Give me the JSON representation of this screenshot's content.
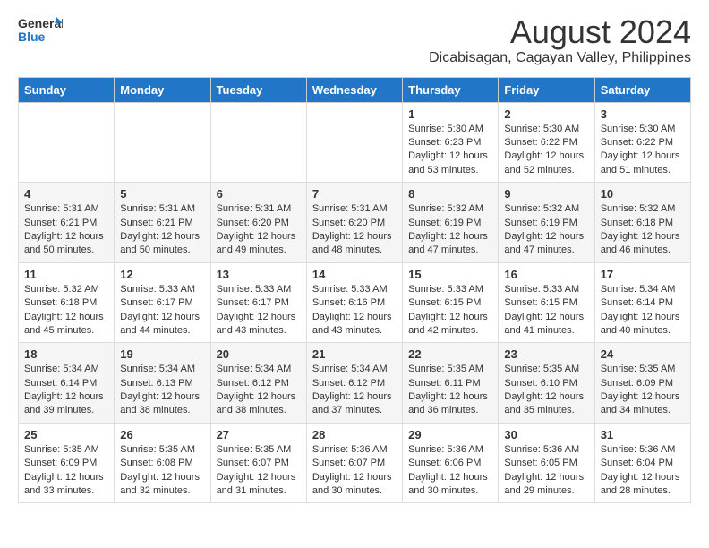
{
  "logo": {
    "line1": "General",
    "line2": "Blue"
  },
  "title": "August 2024",
  "subtitle": "Dicabisagan, Cagayan Valley, Philippines",
  "days_header": [
    "Sunday",
    "Monday",
    "Tuesday",
    "Wednesday",
    "Thursday",
    "Friday",
    "Saturday"
  ],
  "weeks": [
    [
      {
        "day": "",
        "info": ""
      },
      {
        "day": "",
        "info": ""
      },
      {
        "day": "",
        "info": ""
      },
      {
        "day": "",
        "info": ""
      },
      {
        "day": "1",
        "info": "Sunrise: 5:30 AM\nSunset: 6:23 PM\nDaylight: 12 hours\nand 53 minutes."
      },
      {
        "day": "2",
        "info": "Sunrise: 5:30 AM\nSunset: 6:22 PM\nDaylight: 12 hours\nand 52 minutes."
      },
      {
        "day": "3",
        "info": "Sunrise: 5:30 AM\nSunset: 6:22 PM\nDaylight: 12 hours\nand 51 minutes."
      }
    ],
    [
      {
        "day": "4",
        "info": "Sunrise: 5:31 AM\nSunset: 6:21 PM\nDaylight: 12 hours\nand 50 minutes."
      },
      {
        "day": "5",
        "info": "Sunrise: 5:31 AM\nSunset: 6:21 PM\nDaylight: 12 hours\nand 50 minutes."
      },
      {
        "day": "6",
        "info": "Sunrise: 5:31 AM\nSunset: 6:20 PM\nDaylight: 12 hours\nand 49 minutes."
      },
      {
        "day": "7",
        "info": "Sunrise: 5:31 AM\nSunset: 6:20 PM\nDaylight: 12 hours\nand 48 minutes."
      },
      {
        "day": "8",
        "info": "Sunrise: 5:32 AM\nSunset: 6:19 PM\nDaylight: 12 hours\nand 47 minutes."
      },
      {
        "day": "9",
        "info": "Sunrise: 5:32 AM\nSunset: 6:19 PM\nDaylight: 12 hours\nand 47 minutes."
      },
      {
        "day": "10",
        "info": "Sunrise: 5:32 AM\nSunset: 6:18 PM\nDaylight: 12 hours\nand 46 minutes."
      }
    ],
    [
      {
        "day": "11",
        "info": "Sunrise: 5:32 AM\nSunset: 6:18 PM\nDaylight: 12 hours\nand 45 minutes."
      },
      {
        "day": "12",
        "info": "Sunrise: 5:33 AM\nSunset: 6:17 PM\nDaylight: 12 hours\nand 44 minutes."
      },
      {
        "day": "13",
        "info": "Sunrise: 5:33 AM\nSunset: 6:17 PM\nDaylight: 12 hours\nand 43 minutes."
      },
      {
        "day": "14",
        "info": "Sunrise: 5:33 AM\nSunset: 6:16 PM\nDaylight: 12 hours\nand 43 minutes."
      },
      {
        "day": "15",
        "info": "Sunrise: 5:33 AM\nSunset: 6:15 PM\nDaylight: 12 hours\nand 42 minutes."
      },
      {
        "day": "16",
        "info": "Sunrise: 5:33 AM\nSunset: 6:15 PM\nDaylight: 12 hours\nand 41 minutes."
      },
      {
        "day": "17",
        "info": "Sunrise: 5:34 AM\nSunset: 6:14 PM\nDaylight: 12 hours\nand 40 minutes."
      }
    ],
    [
      {
        "day": "18",
        "info": "Sunrise: 5:34 AM\nSunset: 6:14 PM\nDaylight: 12 hours\nand 39 minutes."
      },
      {
        "day": "19",
        "info": "Sunrise: 5:34 AM\nSunset: 6:13 PM\nDaylight: 12 hours\nand 38 minutes."
      },
      {
        "day": "20",
        "info": "Sunrise: 5:34 AM\nSunset: 6:12 PM\nDaylight: 12 hours\nand 38 minutes."
      },
      {
        "day": "21",
        "info": "Sunrise: 5:34 AM\nSunset: 6:12 PM\nDaylight: 12 hours\nand 37 minutes."
      },
      {
        "day": "22",
        "info": "Sunrise: 5:35 AM\nSunset: 6:11 PM\nDaylight: 12 hours\nand 36 minutes."
      },
      {
        "day": "23",
        "info": "Sunrise: 5:35 AM\nSunset: 6:10 PM\nDaylight: 12 hours\nand 35 minutes."
      },
      {
        "day": "24",
        "info": "Sunrise: 5:35 AM\nSunset: 6:09 PM\nDaylight: 12 hours\nand 34 minutes."
      }
    ],
    [
      {
        "day": "25",
        "info": "Sunrise: 5:35 AM\nSunset: 6:09 PM\nDaylight: 12 hours\nand 33 minutes."
      },
      {
        "day": "26",
        "info": "Sunrise: 5:35 AM\nSunset: 6:08 PM\nDaylight: 12 hours\nand 32 minutes."
      },
      {
        "day": "27",
        "info": "Sunrise: 5:35 AM\nSunset: 6:07 PM\nDaylight: 12 hours\nand 31 minutes."
      },
      {
        "day": "28",
        "info": "Sunrise: 5:36 AM\nSunset: 6:07 PM\nDaylight: 12 hours\nand 30 minutes."
      },
      {
        "day": "29",
        "info": "Sunrise: 5:36 AM\nSunset: 6:06 PM\nDaylight: 12 hours\nand 30 minutes."
      },
      {
        "day": "30",
        "info": "Sunrise: 5:36 AM\nSunset: 6:05 PM\nDaylight: 12 hours\nand 29 minutes."
      },
      {
        "day": "31",
        "info": "Sunrise: 5:36 AM\nSunset: 6:04 PM\nDaylight: 12 hours\nand 28 minutes."
      }
    ]
  ]
}
